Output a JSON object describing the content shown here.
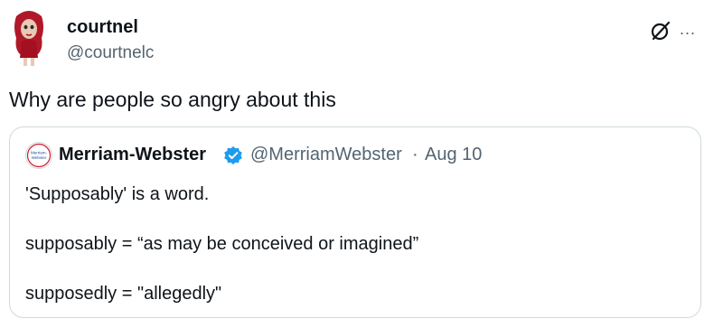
{
  "post": {
    "author_name": "courtnel",
    "author_handle": "@courtnelc",
    "text": "Why are people so angry about this",
    "avatar_icon": "cartoon-character-avatar",
    "grok_icon": "slash-circle-icon",
    "more_icon": "..."
  },
  "quoted": {
    "author_name": "Merriam-Webster",
    "author_handle": "@MerriamWebster",
    "separator": "·",
    "date": "Aug 10",
    "avatar_label_1": "Merriam-",
    "avatar_label_2": "Webster",
    "verified_color": "#1d9bf0",
    "lines": [
      "'Supposably' is a word.",
      "supposably = “as may be conceived or imagined”",
      "supposedly = \"allegedly\""
    ]
  }
}
